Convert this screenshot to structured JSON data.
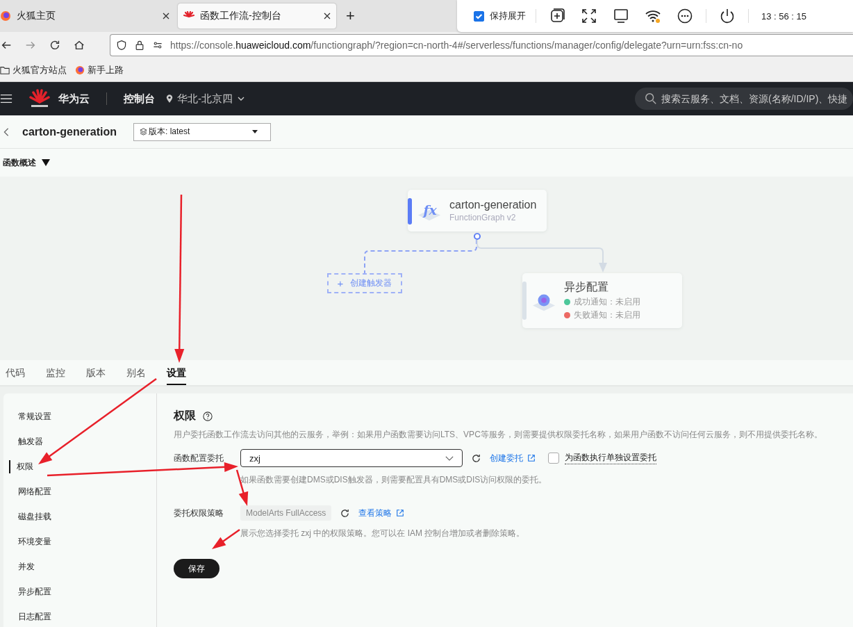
{
  "browser": {
    "tabs": [
      {
        "label": "火狐主页",
        "selected": false
      },
      {
        "label": "函数工作流-控制台",
        "selected": true
      }
    ],
    "new_tab": "+",
    "panel": {
      "keep_expanded": {
        "label": "保持展开",
        "checked": true
      },
      "time": "13 : 56 : 15"
    },
    "url": {
      "prefix": "https://console.",
      "domain": "huaweicloud.com",
      "rest": "/functiongraph/?region=cn-north-4#/serverless/functions/manager/config/delegate?urn=urn:fss:cn-no"
    },
    "bookmarks": [
      {
        "label": "火狐官方站点",
        "kind": "folder"
      },
      {
        "label": "新手上路",
        "kind": "firefox"
      }
    ]
  },
  "header": {
    "brand": "华为云",
    "console": "控制台",
    "region": "华北-北京四",
    "search_placeholder": "搜索云服务、文档、资源(名称/ID/IP)、快捷"
  },
  "function": {
    "name": "carton-generation",
    "version": "版本: latest",
    "overview": "函数概述"
  },
  "canvas": {
    "function_node": {
      "icon_text": "fx",
      "title": "carton-generation",
      "subtitle": "FunctionGraph v2"
    },
    "trigger": "创建触发器",
    "trigger_plus": "+",
    "async_node": {
      "title": "异步配置",
      "statuses": [
        {
          "label": "成功通知：未启用",
          "color": "#4cc79a"
        },
        {
          "label": "失败通知：未启用",
          "color": "#ec6a64"
        }
      ]
    }
  },
  "detail_tabs": [
    {
      "label": "代码",
      "selected": false
    },
    {
      "label": "监控",
      "selected": false
    },
    {
      "label": "版本",
      "selected": false
    },
    {
      "label": "别名",
      "selected": false
    },
    {
      "label": "设置",
      "selected": true
    }
  ],
  "settings_menu": [
    {
      "label": "常规设置",
      "selected": false
    },
    {
      "label": "触发器",
      "selected": false
    },
    {
      "label": "权限",
      "selected": true
    },
    {
      "label": "网络配置",
      "selected": false
    },
    {
      "label": "磁盘挂载",
      "selected": false
    },
    {
      "label": "环境变量",
      "selected": false
    },
    {
      "label": "并发",
      "selected": false
    },
    {
      "label": "异步配置",
      "selected": false
    },
    {
      "label": "日志配置",
      "selected": false
    }
  ],
  "permission": {
    "title": "权限",
    "description": "用户委托函数工作流去访问其他的云服务，举例：如果用户函数需要访问LTS、VPC等服务，则需要提供权限委托名称，如果用户函数不访问任何云服务，则不用提供委托名称。",
    "delegation": {
      "label": "函数配置委托",
      "value": "zxj",
      "create_link": "创建委托",
      "separate": {
        "label": "为函数执行单独设置委托",
        "checked": false
      },
      "hint": "如果函数需要创建DMS或DIS触发器，则需要配置具有DMS或DIS访问权限的委托。"
    },
    "policy": {
      "label": "委托权限策略",
      "tag": "ModelArts FullAccess",
      "view_link": "查看策略",
      "hint": "展示您选择委托 zxj 中的权限策略。您可以在 IAM 控制台增加或者删除策略。"
    },
    "save": "保存"
  }
}
